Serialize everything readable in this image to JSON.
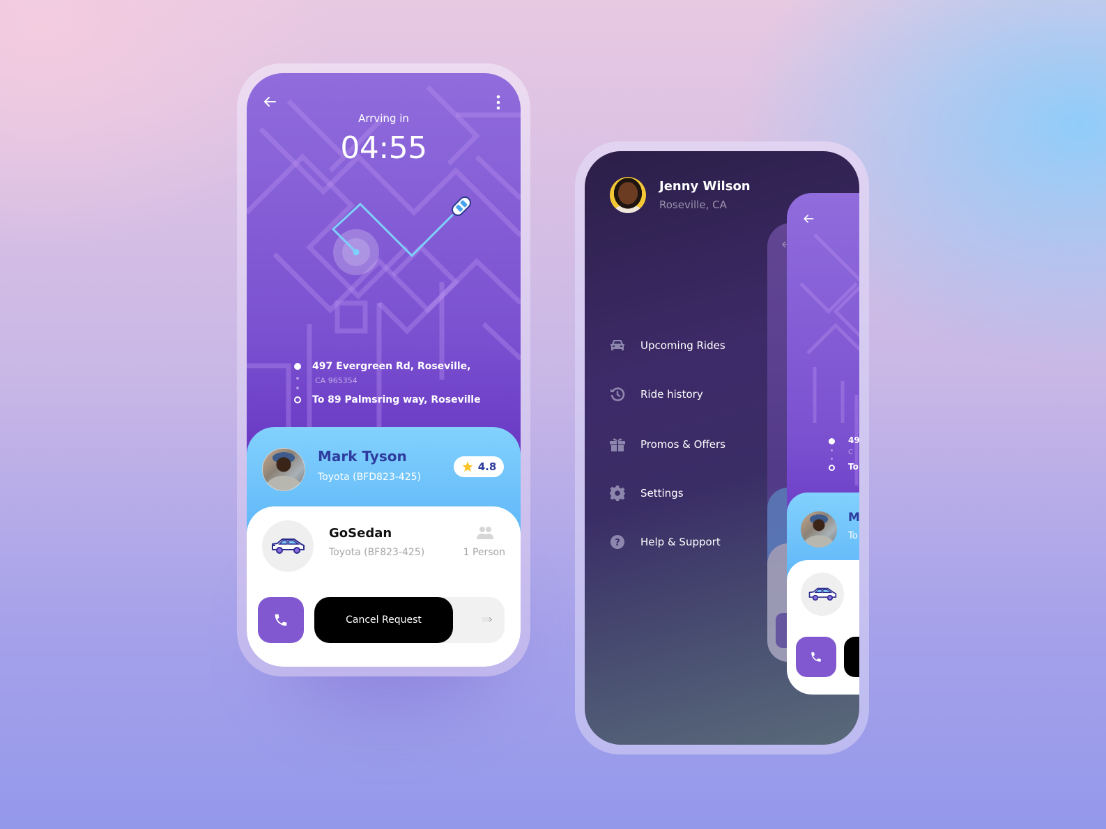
{
  "trip_screen": {
    "back_icon": "arrow-left-icon",
    "more_icon": "more-vertical-icon",
    "arriving_label": "Arrving in",
    "arriving_time": "04:55",
    "route": {
      "pickup_line1": "497 Evergreen Rd, Roseville,",
      "pickup_line2": "CA 965354",
      "destination": "To 89 Palmsring way, Roseville"
    },
    "driver": {
      "name": "Mark Tyson",
      "car": "Toyota (BFD823-425)",
      "rating": "4.8",
      "rating_icon": "star-icon"
    },
    "ride": {
      "type": "GoSedan",
      "car": "Toyota (BF823-425)",
      "capacity": "1 Person",
      "car_icon": "sedan-car-icon",
      "people_icon": "people-icon"
    },
    "actions": {
      "call_icon": "phone-icon",
      "cancel_label": "Cancel Request",
      "slide_hint": "›››",
      "slide_hint_last": "›"
    }
  },
  "menu_screen": {
    "profile": {
      "name": "Jenny Wilson",
      "location": "Roseville, CA"
    },
    "items": [
      {
        "label": "Upcoming Rides",
        "icon": "car-icon"
      },
      {
        "label": "Ride history",
        "icon": "history-icon"
      },
      {
        "label": "Promos & Offers",
        "icon": "gift-icon"
      },
      {
        "label": "Settings",
        "icon": "gear-icon"
      },
      {
        "label": "Help & Support",
        "icon": "help-circle-icon"
      }
    ],
    "peek_screen": {
      "route_pickup_partial": "49",
      "route_sub_partial": "C",
      "route_dest_partial": "To",
      "driver_name_partial": "M",
      "driver_car_partial": "To"
    }
  },
  "colors": {
    "primary_purple": "#8158d0",
    "driver_name_blue": "#2e3c9e",
    "route_line": "#7fd0fb",
    "rating_star": "#f7c325",
    "menu_dark": "#2b1f48"
  }
}
